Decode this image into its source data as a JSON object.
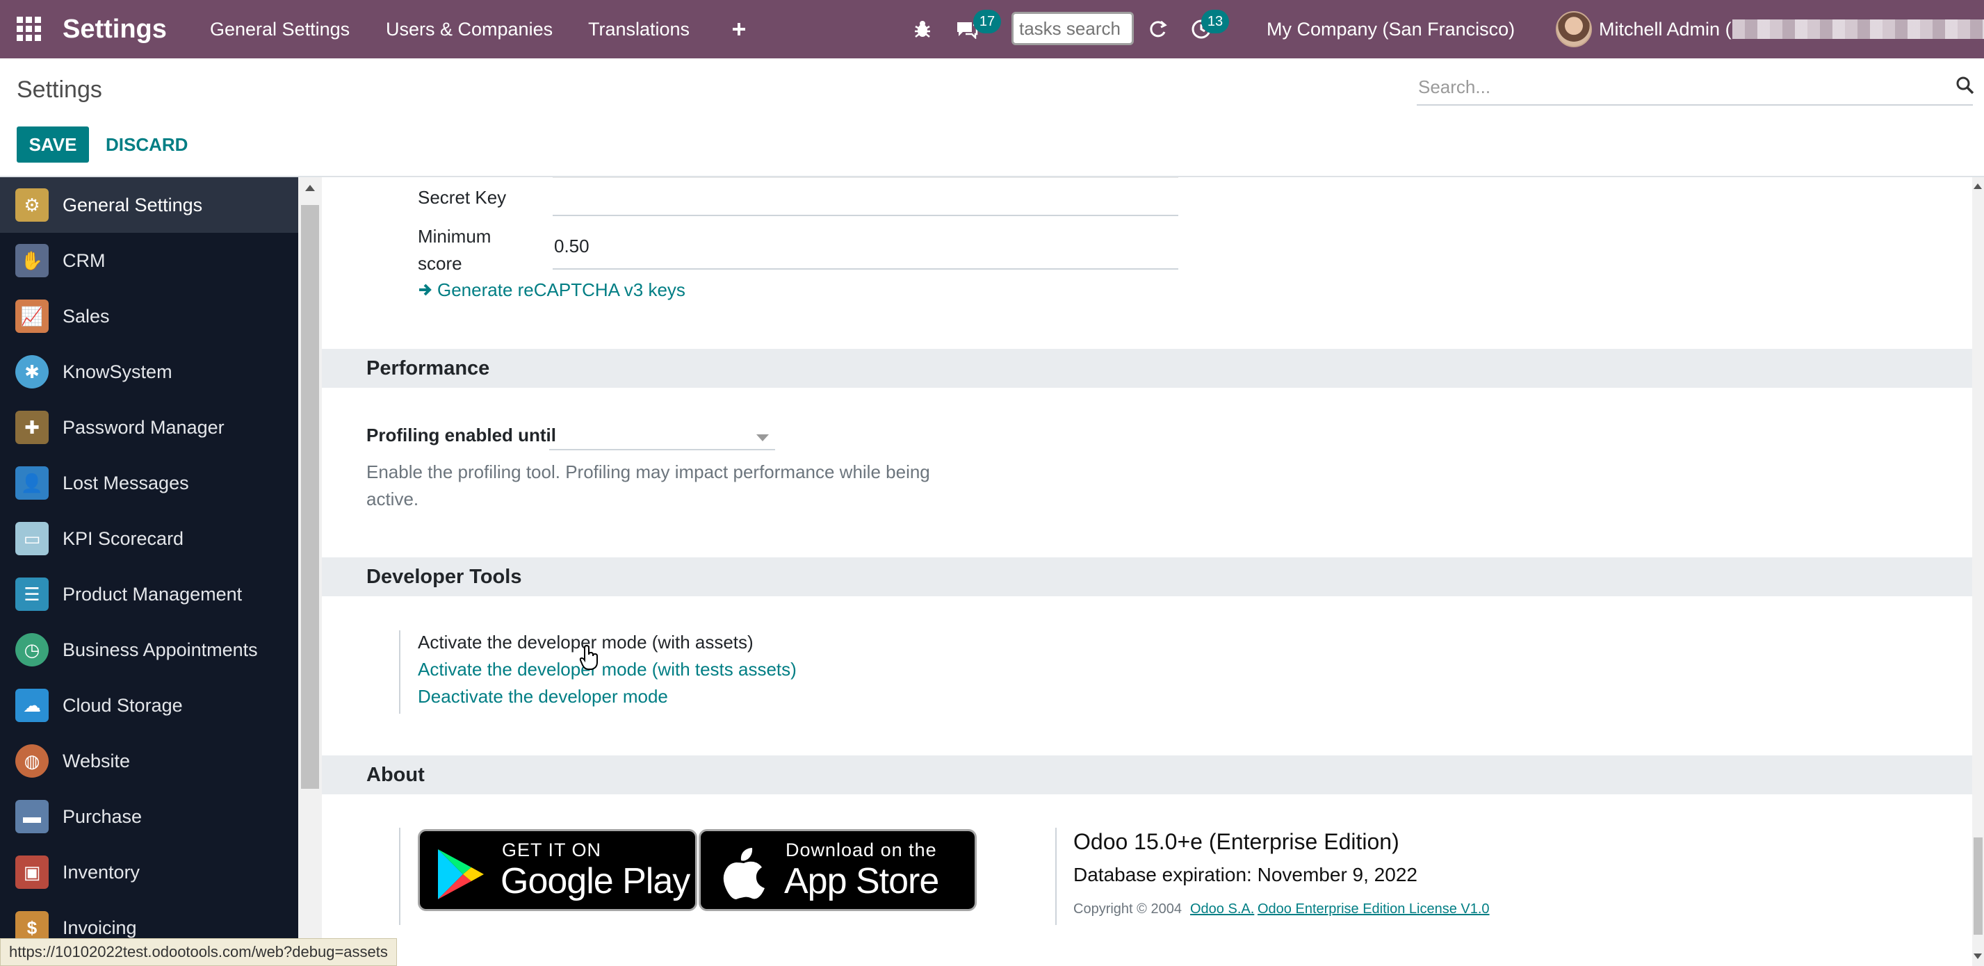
{
  "navbar": {
    "brand": "Settings",
    "menu": [
      "General Settings",
      "Users & Companies",
      "Translations"
    ],
    "chat_count": "17",
    "tasks_search_placeholder": "tasks search",
    "activity_count": "13",
    "company": "My Company (San Francisco)",
    "user": "Mitchell Admin ("
  },
  "control_panel": {
    "title": "Settings",
    "search_placeholder": "Search...",
    "save_label": "SAVE",
    "discard_label": "DISCARD"
  },
  "sidebar": {
    "items": [
      {
        "label": "General Settings",
        "icon": "gear-icon",
        "color": "#c9a24a"
      },
      {
        "label": "CRM",
        "icon": "handshake-icon",
        "color": "#5a6b8c"
      },
      {
        "label": "Sales",
        "icon": "chart-icon",
        "color": "#d27c4a"
      },
      {
        "label": "KnowSystem",
        "icon": "brain-icon",
        "color": "#4aa3d4"
      },
      {
        "label": "Password Manager",
        "icon": "puzzle-icon",
        "color": "#8a6d3b"
      },
      {
        "label": "Lost Messages",
        "icon": "user-icon",
        "color": "#2f80c4"
      },
      {
        "label": "KPI Scorecard",
        "icon": "card-icon",
        "color": "#9fc7d8"
      },
      {
        "label": "Product Management",
        "icon": "sliders-icon",
        "color": "#2d8fb8"
      },
      {
        "label": "Business Appointments",
        "icon": "clock-icon",
        "color": "#3aa37a"
      },
      {
        "label": "Cloud Storage",
        "icon": "cloud-icon",
        "color": "#2a8fd4"
      },
      {
        "label": "Website",
        "icon": "globe-icon",
        "color": "#c4693e"
      },
      {
        "label": "Purchase",
        "icon": "card-icon",
        "color": "#5d7ea8"
      },
      {
        "label": "Inventory",
        "icon": "box-icon",
        "color": "#b84a3e"
      },
      {
        "label": "Invoicing",
        "icon": "invoice-icon",
        "color": "#c98a3a"
      }
    ]
  },
  "recaptcha": {
    "secret_key_label": "Secret Key",
    "min_score_label_1": "Minimum",
    "min_score_label_2": "score",
    "min_score_value": "0.50",
    "generate_link": "Generate reCAPTCHA v3 keys"
  },
  "performance": {
    "title": "Performance",
    "profiling_label": "Profiling enabled until",
    "help_line_1": "Enable the profiling tool. Profiling may impact performance while being",
    "help_line_2": "active."
  },
  "developer_tools": {
    "title": "Developer Tools",
    "activate_assets": "Activate the developer mode (with assets)",
    "activate_tests": "Activate the developer mode (with tests assets)",
    "deactivate": "Deactivate the developer mode"
  },
  "about": {
    "title": "About",
    "google_play_small": "GET IT ON",
    "google_play_big": "Google Play",
    "app_store_small": "Download on the",
    "app_store_big": "App Store",
    "version": "Odoo 15.0+e (Enterprise Edition)",
    "expiration": "Database expiration: November 9, 2022",
    "copyright": "Copyright © 2004",
    "odoo_sa": "Odoo S.A.",
    "license": "Odoo Enterprise Edition License V1.0"
  },
  "status_url": "https://10102022test.odootools.com/web?debug=assets",
  "colors": {
    "navbar": "#714b67",
    "accent": "#017e84",
    "sidebar": "#111827"
  }
}
